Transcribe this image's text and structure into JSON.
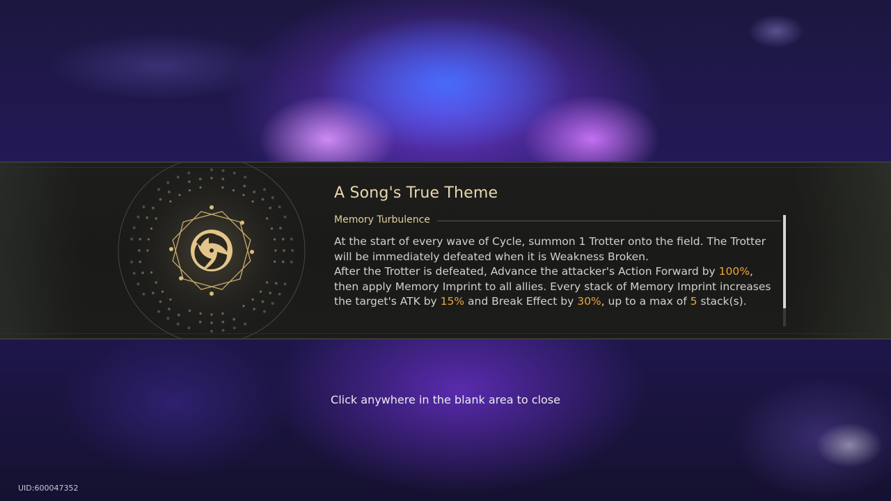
{
  "event": {
    "title": "A Song's True Theme",
    "subtitle": "Memory Turbulence",
    "icon": "swirl-emblem-icon"
  },
  "description": {
    "line1": "At the start of every wave of Cycle, summon 1 Trotter onto the field. The Trotter will be immediately defeated when it is Weakness Broken.",
    "line2_a": "After the Trotter is defeated, Advance the attacker's Action Forward by ",
    "line2_val": "100%",
    "line2_b": ", then apply Memory Imprint to all allies. Every stack of Memory Imprint increases the target's ATK by ",
    "line2_atk": "15%",
    "line2_c": " and Break Effect by ",
    "line2_break": "30%",
    "line2_d": ", up to a max of ",
    "line2_max": "5",
    "line2_e": " stack(s)."
  },
  "scroll": {
    "position": 0.0,
    "visible_fraction": 0.84
  },
  "close_hint": "Click anywhere in the blank area to close",
  "uid": "UID:600047352",
  "colors": {
    "title": "#e9d8ad",
    "highlight": "#f0a53b",
    "banner": "#1c1c1a",
    "text": "#d3d1c9"
  }
}
